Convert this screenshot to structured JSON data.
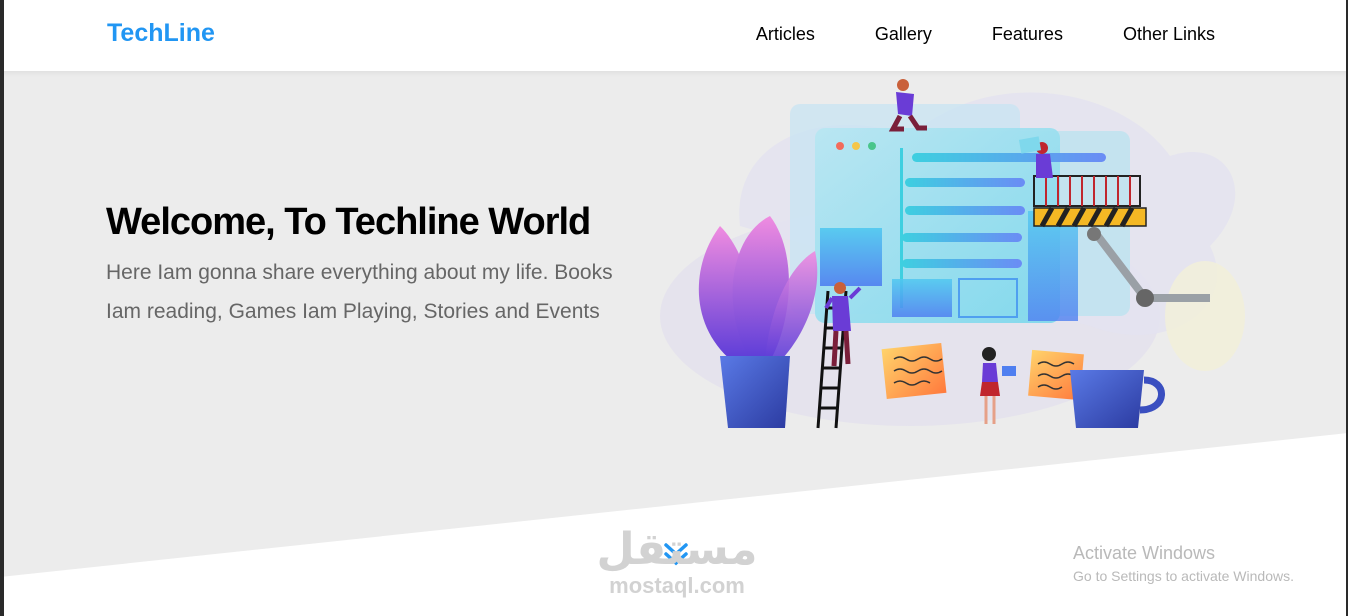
{
  "header": {
    "logo": "TechLine",
    "nav": [
      {
        "label": "Articles"
      },
      {
        "label": "Gallery"
      },
      {
        "label": "Features"
      },
      {
        "label": "Other Links"
      }
    ]
  },
  "landing": {
    "title": "Welcome, To Techline World",
    "description": "Here Iam gonna share everything about my life. Books Iam reading, Games Iam Playing, Stories and Events"
  },
  "watermark": {
    "arabic": "مستقل",
    "latin": "mostaql.com"
  },
  "activation": {
    "line1": "Activate Windows",
    "line2": "Go to Settings to activate Windows."
  },
  "colors": {
    "brand": "#2196f3",
    "landing_bg": "#ececec",
    "text_muted": "#666666"
  }
}
